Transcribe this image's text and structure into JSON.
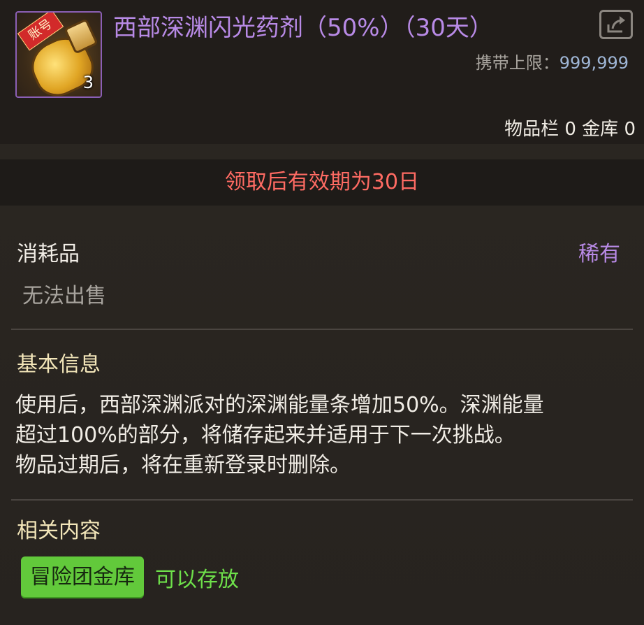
{
  "item": {
    "name": "西部深渊闪光药剂（50%）（30天）",
    "account_tag": "账号",
    "stack_count": "3",
    "icon": "potion-bottle-icon"
  },
  "carry_limit": {
    "label": "携带上限：",
    "value": "999,999"
  },
  "storage": "物品栏 0 金库 0",
  "expiry_note": "领取后有效期为30日",
  "category": "消耗品",
  "rarity": "稀有",
  "sell_note": "无法出售",
  "basic_info": {
    "heading": "基本信息",
    "lines": [
      "使用后，西部深渊派对的深渊能量条增加50%。深渊能量",
      "超过100%的部分，将储存起来并适用于下一次挑战。",
      "物品过期后，将在重新登录时删除。"
    ]
  },
  "related": {
    "heading": "相关内容",
    "vault_button": "冒险团金库",
    "vault_status": "可以存放"
  },
  "colors": {
    "title": "#b88ae6",
    "expiry": "#ff6b63",
    "rare": "#b88ae6",
    "heading": "#f3e6b9",
    "vault_button": "#62c93b",
    "vault_status": "#6ee04a"
  },
  "icons": [
    "potion-bottle-icon",
    "share-icon"
  ]
}
